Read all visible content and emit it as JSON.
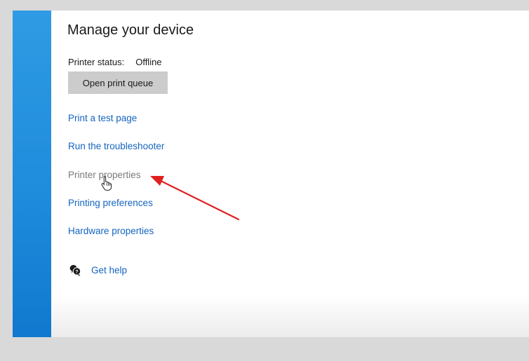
{
  "page": {
    "title": "Manage your device"
  },
  "status": {
    "label": "Printer status:",
    "value": "Offline"
  },
  "actions": {
    "open_queue_label": "Open print queue"
  },
  "links": [
    {
      "label": "Print a test page"
    },
    {
      "label": "Run the troubleshooter"
    },
    {
      "label": "Printer properties"
    },
    {
      "label": "Printing preferences"
    },
    {
      "label": "Hardware properties"
    }
  ],
  "help": {
    "label": "Get help",
    "icon": "get-help-icon"
  },
  "annotation": {
    "type": "arrow",
    "color": "#e02020",
    "points_to": "Printer properties"
  },
  "colors": {
    "accent": "#1f8cdc",
    "link": "#1565c0",
    "hover_link": "#7a7a7a",
    "button_bg": "#cccccc"
  }
}
